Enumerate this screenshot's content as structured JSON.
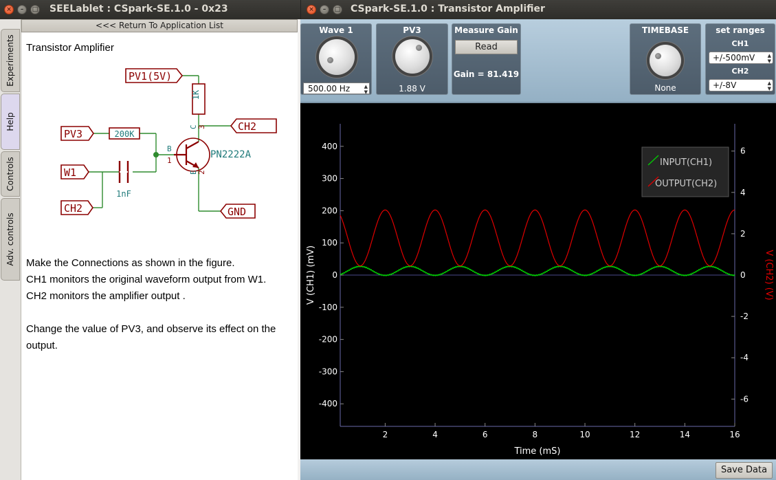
{
  "left_window": {
    "title": "SEELablet : CSpark-SE.1.0 - 0x23",
    "tabs": [
      "Experiments",
      "Help",
      "Controls",
      "Adv. controls"
    ],
    "return_label": "<<< Return To Application List",
    "help": {
      "heading": "Transistor Amplifier",
      "paragraph1": [
        "Make the Connections as shown in the figure.",
        "CH1 monitors the original waveform output from W1.",
        "CH2 monitors the amplifier output ."
      ],
      "paragraph2": [
        "Change the value of PV3, and observe its effect on the",
        "output."
      ]
    },
    "schematic": {
      "labels": {
        "pv1": "PV1(5V)",
        "pv3": "PV3",
        "w1": "W1",
        "ch2_in": "CH2",
        "ch2_out": "CH2",
        "gnd": "GND"
      },
      "parts": {
        "r_collector": "1K",
        "r_base": "200K",
        "capacitor": "1nF",
        "transistor": "PN2222A"
      },
      "pins": {
        "base": "B",
        "pin1": "1",
        "collector": "C",
        "pin3": "3",
        "emitter": "E",
        "pin2": "2"
      },
      "colors": {
        "wire": "#2e8b2e",
        "label": "#8b0000",
        "part_text": "#1f7a7a",
        "junction": "#2e8b2e"
      }
    }
  },
  "right_window": {
    "title": "CSpark-SE.1.0 : Transistor Amplifier",
    "panels": {
      "wave1": {
        "title": "Wave 1",
        "value": "500.00 Hz"
      },
      "pv3": {
        "title": "PV3",
        "value": "1.88  V"
      },
      "measure_gain": {
        "title": "Measure Gain",
        "button": "Read",
        "gain_text": "Gain = 81.419"
      },
      "timebase": {
        "title": "TIMEBASE",
        "value": "None"
      },
      "ranges": {
        "title": "set ranges",
        "ch1_label": "CH1",
        "ch1_value": "+/-500mV",
        "ch2_label": "CH2",
        "ch2_value": "+/-8V"
      }
    },
    "save_button": "Save Data"
  },
  "chart_data": {
    "type": "line",
    "title": "",
    "xlabel": "Time (mS)",
    "ylabel": "V (CH1) (mV)",
    "y2label": "V (CH2) (V)",
    "xlim": [
      0.2,
      16
    ],
    "ylim": [
      -470,
      470
    ],
    "y2lim": [
      -7.32,
      7.32
    ],
    "x_ticks": [
      "2",
      "4",
      "6",
      "8",
      "10",
      "12",
      "14",
      "16"
    ],
    "y_ticks": [
      400,
      300,
      200,
      100,
      0,
      -100,
      -200,
      -300,
      -400
    ],
    "y2_ticks": [
      6,
      4,
      2,
      0,
      -2,
      -4,
      -6
    ],
    "grid": false,
    "legend_position": "top-right",
    "series": [
      {
        "name": "INPUT(CH1)",
        "axis": "left",
        "color": "#00d400",
        "shape": "sine",
        "frequency_khz": 0.5,
        "offset_mv": 13,
        "amplitude_mv": 14,
        "phase_deg": 0
      },
      {
        "name": "OUTPUT(CH2)",
        "axis": "right",
        "color": "#e00000",
        "shape": "sine",
        "frequency_khz": 0.5,
        "offset_v": 1.8,
        "amplitude_v": 1.35,
        "phase_deg": 180
      }
    ]
  }
}
